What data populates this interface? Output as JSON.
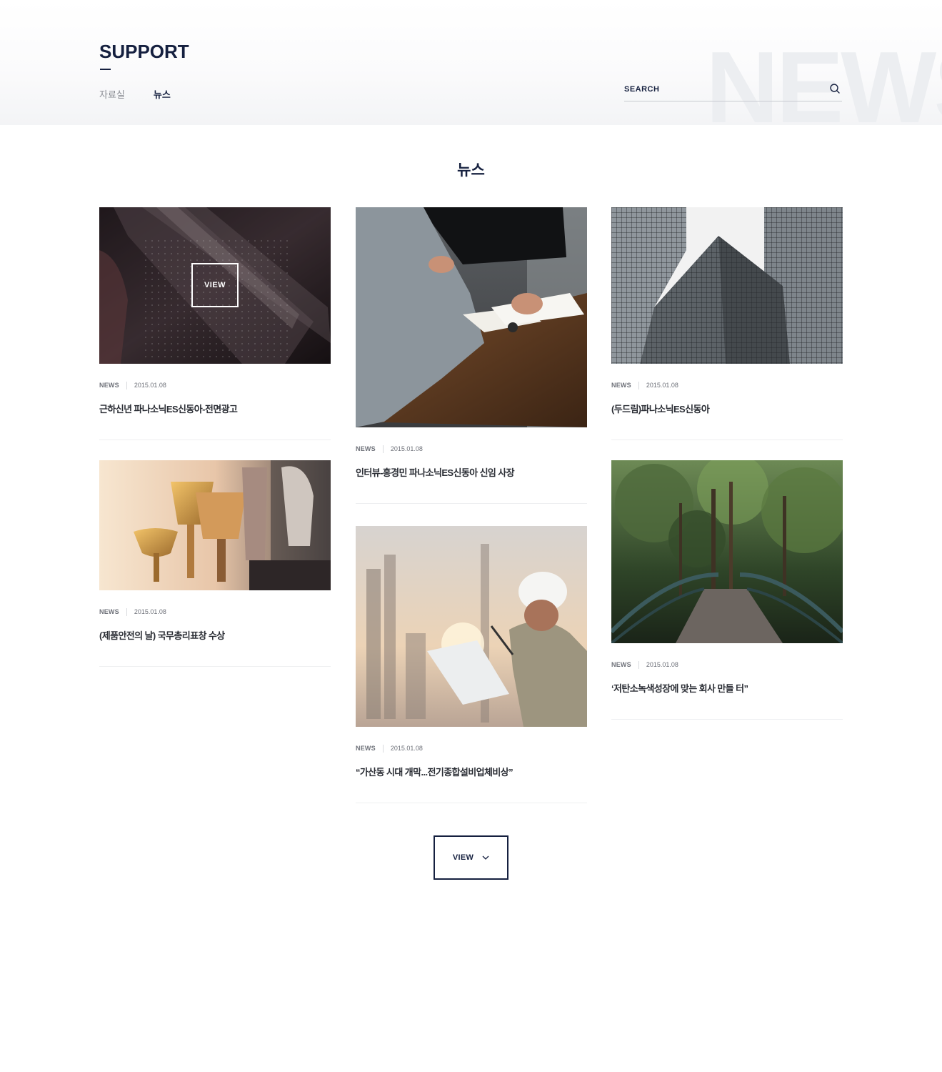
{
  "header": {
    "section_title": "SUPPORT",
    "background_word": "NEWS",
    "sub_nav": [
      {
        "label": "자료실",
        "active": false
      },
      {
        "label": "뉴스",
        "active": true
      }
    ],
    "search": {
      "placeholder": "SEARCH",
      "value": ""
    }
  },
  "page_title": "뉴스",
  "cards": [
    {
      "category": "NEWS",
      "date": "2015.01.08",
      "title": "근하신년 파나소닉ES신동아-전면광고",
      "hover_label": "VIEW",
      "image_icon": "open-book-photo"
    },
    {
      "category": "NEWS",
      "date": "2015.01.08",
      "title": "인터뷰-홍경민 파나소닉ES신동아 신임 사장",
      "image_icon": "meeting-photo"
    },
    {
      "category": "NEWS",
      "date": "2015.01.08",
      "title": "(두드림)파나소닉ES신동아",
      "image_icon": "skyscraper-photo"
    },
    {
      "category": "NEWS",
      "date": "2015.01.08",
      "title": "(제품안전의 날) 국무총리표창 수상",
      "image_icon": "trophy-photo"
    },
    {
      "category": "NEWS",
      "date": "2015.01.08",
      "title": "“가산동 시대 개막...전기종합설비업체비상”",
      "image_icon": "engineer-photo"
    },
    {
      "category": "NEWS",
      "date": "2015.01.08",
      "title": "‘저탄소녹색성장에 맞는 회사 만들 터”",
      "image_icon": "forest-bridge-photo"
    }
  ],
  "more_button": {
    "label": "VIEW",
    "icon": "chevron-down-icon"
  },
  "colors": {
    "navy": "#15203f",
    "muted": "#8a8c93",
    "meta": "#6d7078"
  }
}
